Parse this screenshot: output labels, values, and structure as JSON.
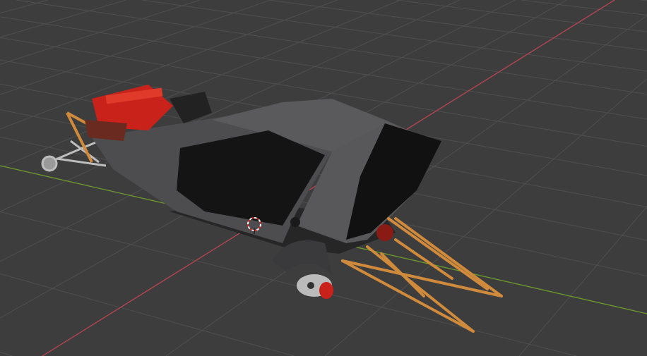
{
  "viewport": {
    "background_color": "#3d3d3d",
    "grid_color": "#4f4f4f",
    "x_axis_color": "#b8454f",
    "y_axis_color": "#6c9a2c"
  },
  "model": {
    "body_color": "#4a4a4c",
    "engine_color": "#c8221a",
    "frame_color": "#d08a3c"
  },
  "icons": [
    "3d-cursor-icon"
  ]
}
